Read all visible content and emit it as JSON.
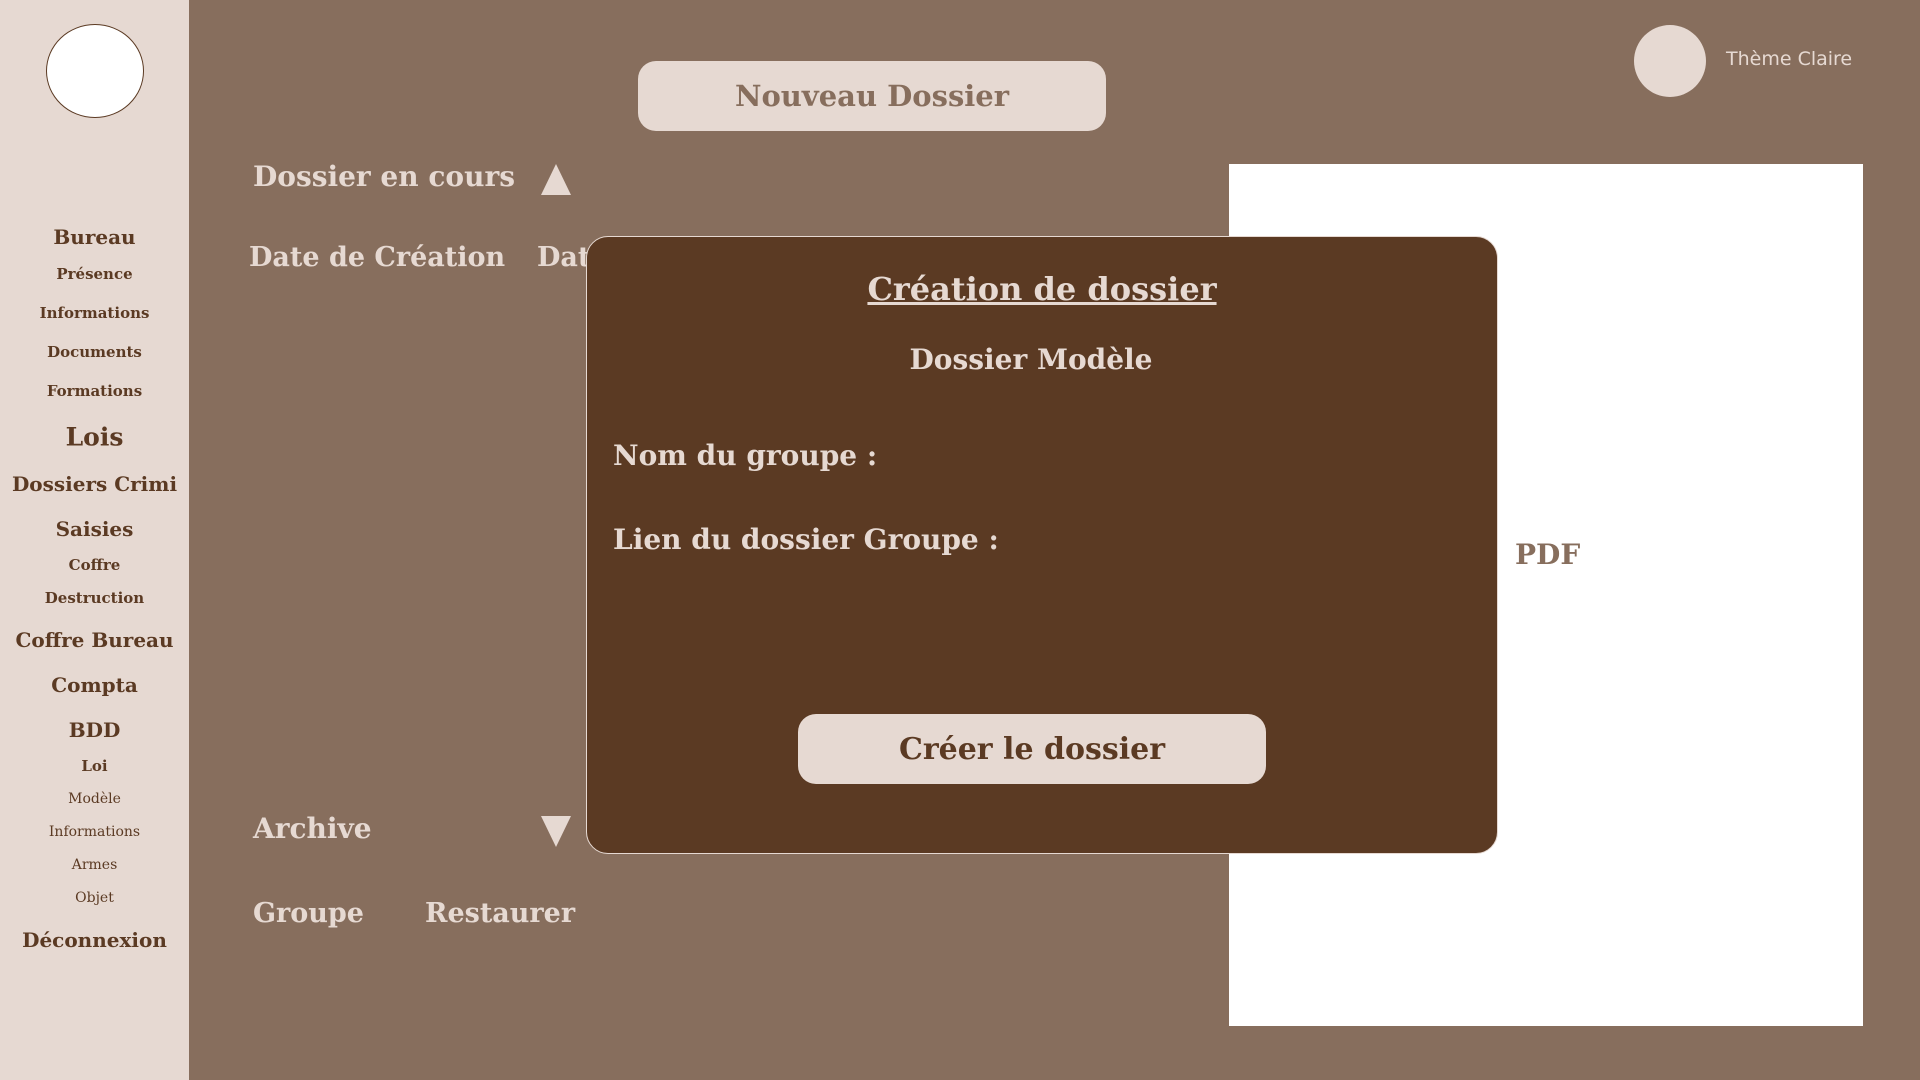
{
  "sidebar": {
    "items": [
      {
        "label": "Bureau",
        "size": "l"
      },
      {
        "label": "Présence",
        "size": "s"
      },
      {
        "label": "Informations",
        "size": "s"
      },
      {
        "label": "Documents",
        "size": "s"
      },
      {
        "label": "Formations",
        "size": "s"
      },
      {
        "label": "Lois",
        "size": "xl"
      },
      {
        "label": "Dossiers Crimi",
        "size": "l"
      },
      {
        "label": "Saisies",
        "size": "l"
      },
      {
        "label": "Coffre",
        "size": "s"
      },
      {
        "label": "Destruction",
        "size": "s"
      },
      {
        "label": "Coffre Bureau",
        "size": "l"
      },
      {
        "label": "Compta",
        "size": "l"
      },
      {
        "label": "BDD",
        "size": "l"
      },
      {
        "label": "Loi",
        "size": "s"
      },
      {
        "label": "Modèle",
        "size": "sn"
      },
      {
        "label": "Informations",
        "size": "sn"
      },
      {
        "label": "Armes",
        "size": "sn"
      },
      {
        "label": "Objet",
        "size": "sn"
      },
      {
        "label": "Déconnexion",
        "size": "l"
      }
    ]
  },
  "header": {
    "new_folder_label": "Nouveau Dossier",
    "theme_label": "Thème Claire"
  },
  "current": {
    "title": "Dossier en cours",
    "col_creation": "Date de Création",
    "col_date_partial": "Dat"
  },
  "archive": {
    "title": "Archive",
    "col_group": "Groupe",
    "col_restore": "Restaurer"
  },
  "pdf_panel": {
    "label": "PDF"
  },
  "modal": {
    "title": "Création de dossier",
    "subtitle": "Dossier Modèle",
    "group_name_label": "Nom du groupe :",
    "group_link_label": "Lien du dossier Groupe :",
    "create_button": "Créer le dossier"
  },
  "colors": {
    "background": "#876e5d",
    "sidebar": "#e6d9d2",
    "modal": "#5b3a23",
    "text_light": "#e6d9d2"
  }
}
